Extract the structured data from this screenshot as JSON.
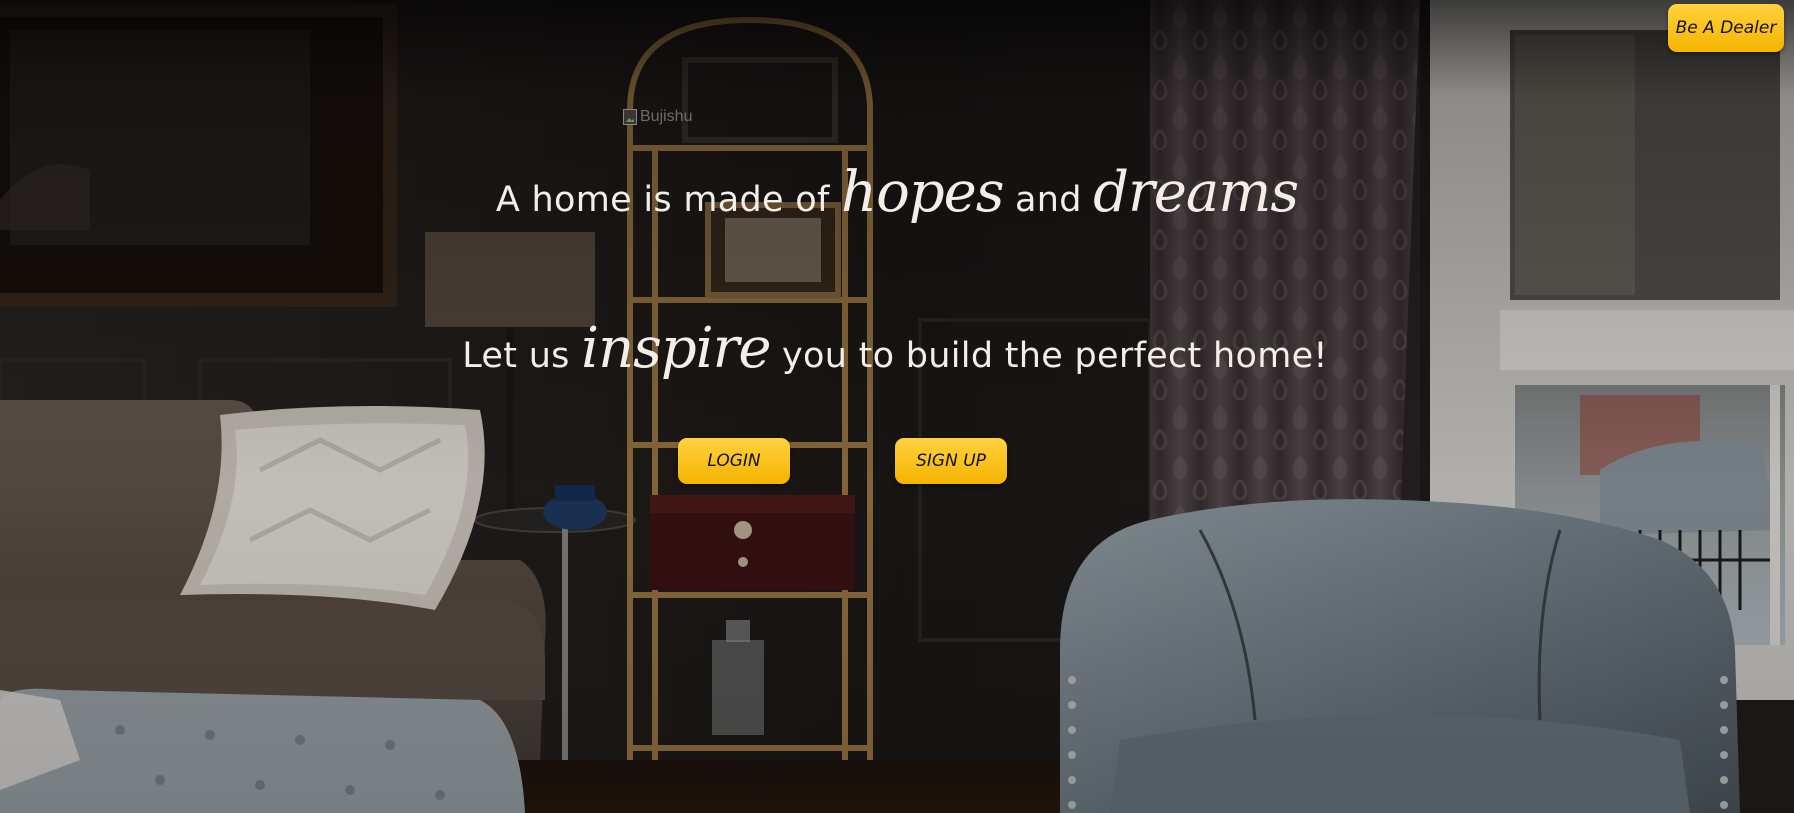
{
  "header": {
    "dealer_button_label": "Be A Dealer"
  },
  "logo": {
    "alt_text": "Bujishu"
  },
  "hero": {
    "line1": {
      "before": "A home is made of ",
      "script1": "hopes",
      "middle": " and ",
      "script2": "dreams"
    },
    "line2": {
      "before": "Let us ",
      "script": "inspire",
      "after": " you to build the perfect home!"
    }
  },
  "actions": {
    "login_label": "LOGIN",
    "signup_label": "SIGN UP"
  },
  "colors": {
    "accent": "#ffc81e",
    "text": "#f3eee8",
    "background": "#14110f"
  }
}
